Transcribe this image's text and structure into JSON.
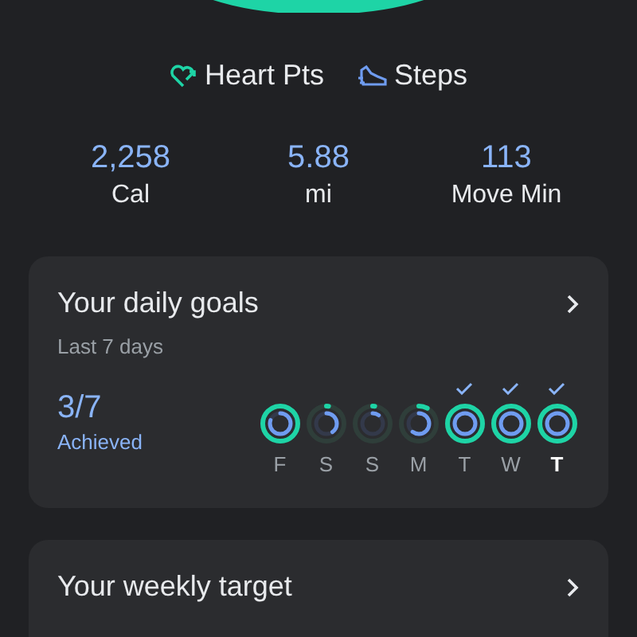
{
  "legend": [
    {
      "label": "Heart Pts",
      "kind": "heart"
    },
    {
      "label": "Steps",
      "kind": "steps"
    }
  ],
  "stats": [
    {
      "value": "2,258",
      "label": "Cal"
    },
    {
      "value": "5.88",
      "label": "mi"
    },
    {
      "value": "113",
      "label": "Move Min"
    }
  ],
  "daily_goals": {
    "title": "Your daily goals",
    "subtitle": "Last 7 days",
    "achieved_count": "3/7",
    "achieved_label": "Achieved",
    "days": [
      {
        "letter": "F",
        "rings": [
          {
            "kind": "heart",
            "level": 1
          },
          {
            "kind": "steps"
          }
        ],
        "checked": false,
        "selected": false
      },
      {
        "letter": "S",
        "rings": [
          {
            "kind": "heart",
            "level": 0.02
          },
          {
            "kind": "steps"
          }
        ],
        "checked": false,
        "selected": false
      },
      {
        "letter": "S",
        "rings": [
          {
            "kind": "heart",
            "level": 0.02
          },
          {
            "kind": "steps"
          }
        ],
        "checked": false,
        "selected": false
      },
      {
        "letter": "M",
        "rings": [
          {
            "kind": "heart",
            "level": 0.08
          },
          {
            "kind": "steps"
          }
        ],
        "checked": false,
        "selected": false
      },
      {
        "letter": "T",
        "rings": [
          {
            "kind": "heart",
            "level": 1
          },
          {
            "kind": "steps"
          }
        ],
        "checked": true,
        "selected": false
      },
      {
        "letter": "W",
        "rings": [
          {
            "kind": "heart",
            "level": 1
          },
          {
            "kind": "steps"
          }
        ],
        "checked": true,
        "selected": false
      },
      {
        "letter": "T",
        "rings": [
          {
            "kind": "heart",
            "level": 1
          },
          {
            "kind": "steps"
          }
        ],
        "checked": true,
        "selected": true
      }
    ]
  },
  "weekly_target": {
    "title": "Your weekly target"
  }
}
